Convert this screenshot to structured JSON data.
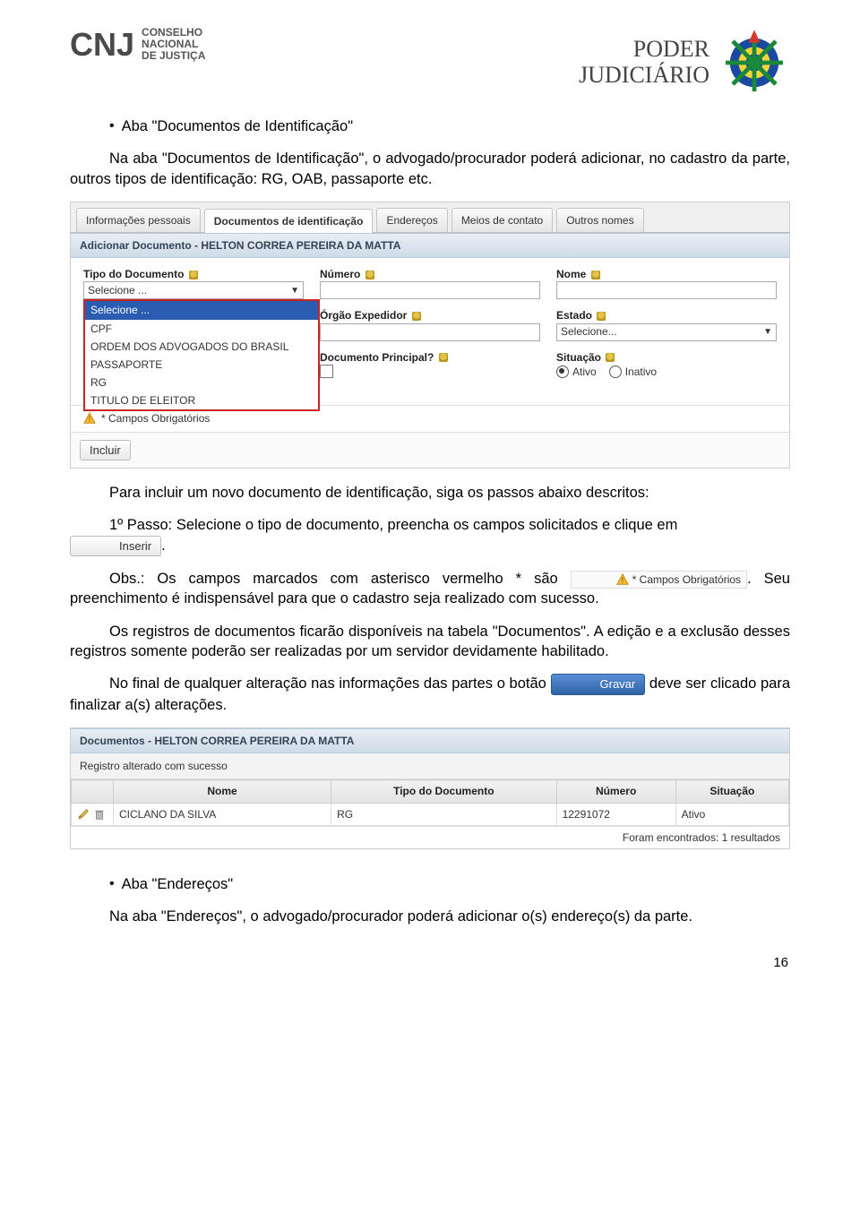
{
  "header": {
    "cnj_letters": "CNJ",
    "cnj_sub1": "CONSELHO",
    "cnj_sub2": "NACIONAL",
    "cnj_sub3": "DE JUSTIÇA",
    "poder_line1": "PODER",
    "poder_line2": "JUDICIÁRIO"
  },
  "doc": {
    "bullet1_title": "Aba \"Documentos de Identificação\"",
    "para1": "Na aba \"Documentos de Identificação\", o advogado/procurador poderá adicionar, no cadastro da parte, outros tipos de identificação: RG, OAB, passaporte etc.",
    "para2a": "Para incluir um novo documento de identificação, siga os passos abaixo descritos:",
    "para2b_pre": "1º Passo: Selecione o tipo de documento, preencha os campos solicitados e clique em",
    "para2b_post": ".",
    "inserir_btn": "Inserir",
    "para3_pre": "Obs.: Os campos marcados com asterisco vermelho * são",
    "para3_chip": "* Campos Obrigatórios",
    "para3_post": ". Seu preenchimento é indispensável para que o cadastro seja realizado com sucesso.",
    "para4": "Os registros de documentos ficarão disponíveis na tabela \"Documentos\". A edição e a exclusão desses registros somente poderão ser realizadas por um servidor devidamente habilitado.",
    "para5_pre": "No final de qualquer alteração nas informações das partes o botão ",
    "gravar_btn": "Gravar",
    "para5_post": " deve ser clicado para finalizar a(s) alterações.",
    "bullet2_title": "Aba \"Endereços\"",
    "para6": "Na aba \"Endereços\", o advogado/procurador poderá adicionar o(s) endereço(s) da parte.",
    "pagenum": "16"
  },
  "shot1": {
    "tabs": [
      "Informações pessoais",
      "Documentos de identificação",
      "Endereços",
      "Meios de contato",
      "Outros nomes"
    ],
    "active_tab_index": 1,
    "section_title": "Adicionar Documento - HELTON CORREA PEREIRA DA MATTA",
    "labels": {
      "tipo": "Tipo do Documento",
      "numero": "Número",
      "nome": "Nome",
      "orgao": "Órgão Expedidor",
      "estado": "Estado",
      "doc_principal": "Documento Principal?",
      "situacao": "Situação"
    },
    "tipo_selected": "Selecione ...",
    "tipo_options": [
      "Selecione ...",
      "CPF",
      "ORDEM DOS ADVOGADOS DO BRASIL",
      "PASSAPORTE",
      "RG",
      "TITULO DE ELEITOR"
    ],
    "estado_placeholder": "Selecione...",
    "situacao": {
      "ativo": "Ativo",
      "inativo": "Inativo"
    },
    "campos_obrig": "* Campos Obrigatórios",
    "incluir_btn": "Incluir"
  },
  "shot2": {
    "section_title": "Documentos - HELTON CORREA PEREIRA DA MATTA",
    "success_msg": "Registro alterado com sucesso",
    "columns": [
      "Nome",
      "Tipo do Documento",
      "Número",
      "Situação"
    ],
    "row": {
      "nome": "CICLANO DA SILVA",
      "tipo": "RG",
      "numero": "12291072",
      "situacao": "Ativo"
    },
    "footer": "Foram encontrados: 1 resultados"
  }
}
